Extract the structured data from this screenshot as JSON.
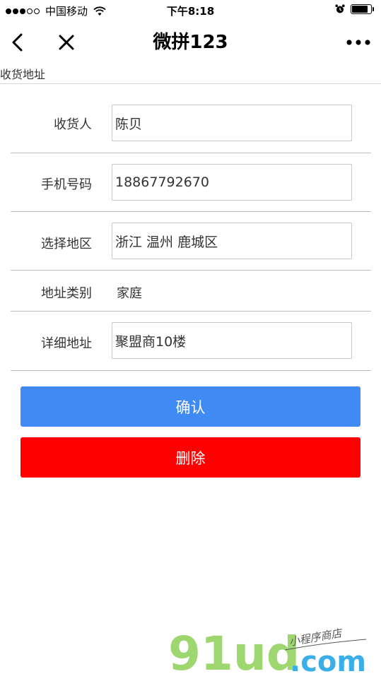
{
  "status_bar": {
    "carrier": "中国移动",
    "time": "下午8:18",
    "signal_strength": 3,
    "signal_max": 5,
    "battery_level": 0.85
  },
  "navbar": {
    "title": "微拼123",
    "back_icon": "chevron-left-icon",
    "close_icon": "close-icon",
    "more_icon": "more-dots-icon"
  },
  "page": {
    "label": "收货地址"
  },
  "form": {
    "receiver": {
      "label": "收货人",
      "value": "陈贝"
    },
    "phone": {
      "label": "手机号码",
      "value": "18867792670"
    },
    "region": {
      "label": "选择地区",
      "value": "浙江 温州 鹿城区"
    },
    "address_type": {
      "label": "地址类别",
      "value": "家庭"
    },
    "detail": {
      "label": "详细地址",
      "value": "聚盟商10楼"
    }
  },
  "actions": {
    "confirm_label": "确认",
    "delete_label": "删除"
  },
  "watermark": {
    "brand": "91ud",
    "domain": ".com",
    "tagline": "小程序商店"
  },
  "colors": {
    "confirm": "#3f8af3",
    "delete": "#ff0000",
    "watermark_green": "#9ed76f",
    "watermark_blue": "#3aaee8"
  }
}
